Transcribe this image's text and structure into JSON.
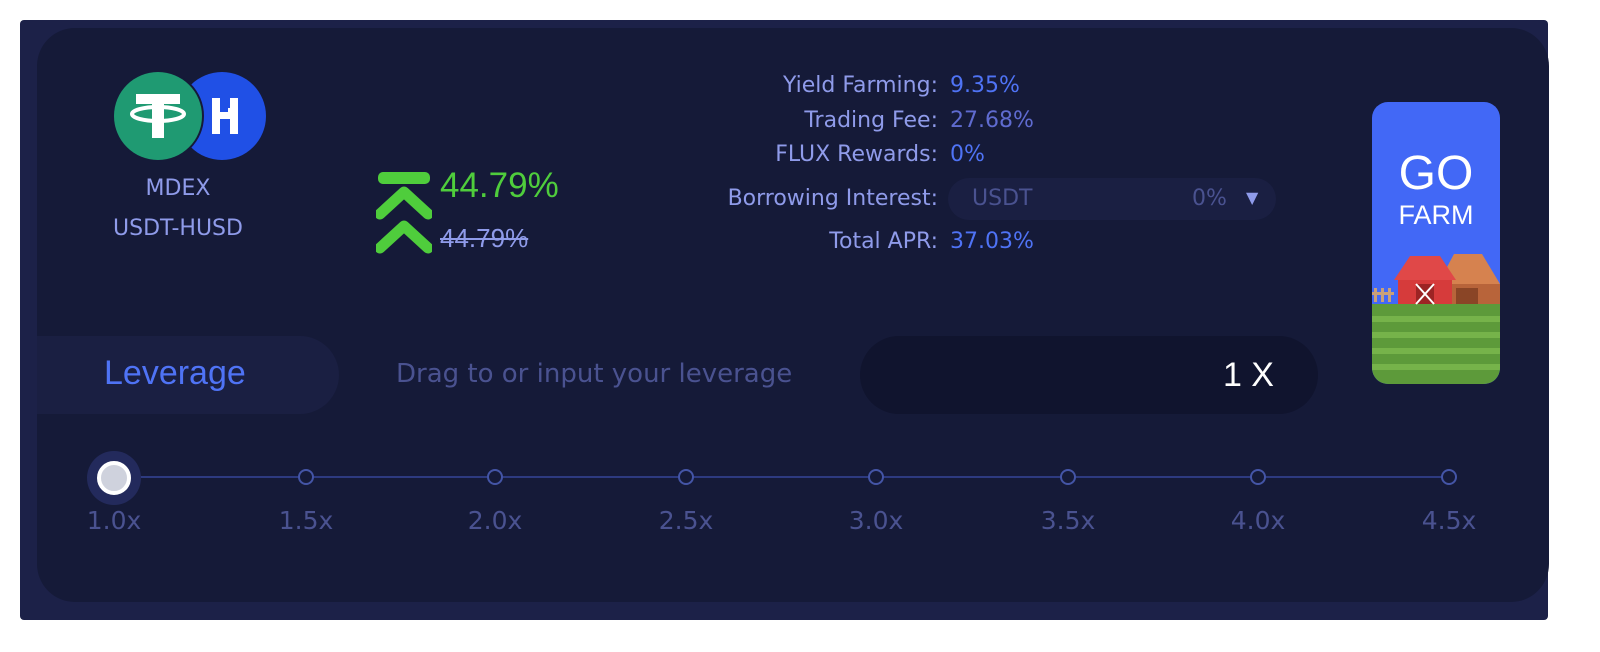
{
  "pool": {
    "exchange": "MDEX",
    "pair": "USDT-HUSD",
    "tokens": [
      {
        "symbol": "USDT",
        "icon": "usdt-logo-icon",
        "color": "#1f9a72"
      },
      {
        "symbol": "HUSD",
        "icon": "husd-logo-icon",
        "color": "#2050e6"
      }
    ]
  },
  "apr": {
    "boosted": "44.79%",
    "original": "44.79%",
    "icon": "double-chevron-up-icon",
    "color": "#4fcd3c"
  },
  "stats": {
    "yield_farming": {
      "label": "Yield Farming:",
      "value": "9.35%"
    },
    "trading_fee": {
      "label": "Trading Fee:",
      "value": "27.68%"
    },
    "flux_rewards": {
      "label": "FLUX Rewards:",
      "value": "0%"
    },
    "borrowing_interest": {
      "label": "Borrowing Interest:",
      "token": "USDT",
      "rate": "0%",
      "caret": "▼"
    },
    "total_apr": {
      "label": "Total APR:",
      "value": "37.03%"
    }
  },
  "go_farm": {
    "line1": "GO",
    "line2": "FARM",
    "art": "barn-farm-icon"
  },
  "leverage": {
    "title": "Leverage",
    "hint": "Drag to or input your leverage",
    "value": "1 X",
    "current": 1.0,
    "marks": [
      "1.0x",
      "1.5x",
      "2.0x",
      "2.5x",
      "3.0x",
      "3.5x",
      "4.0x",
      "4.5x"
    ]
  },
  "colors": {
    "background": "#151a38",
    "accent": "#4f73f5",
    "label": "#8f9bea",
    "positive": "#4fcd3c"
  }
}
